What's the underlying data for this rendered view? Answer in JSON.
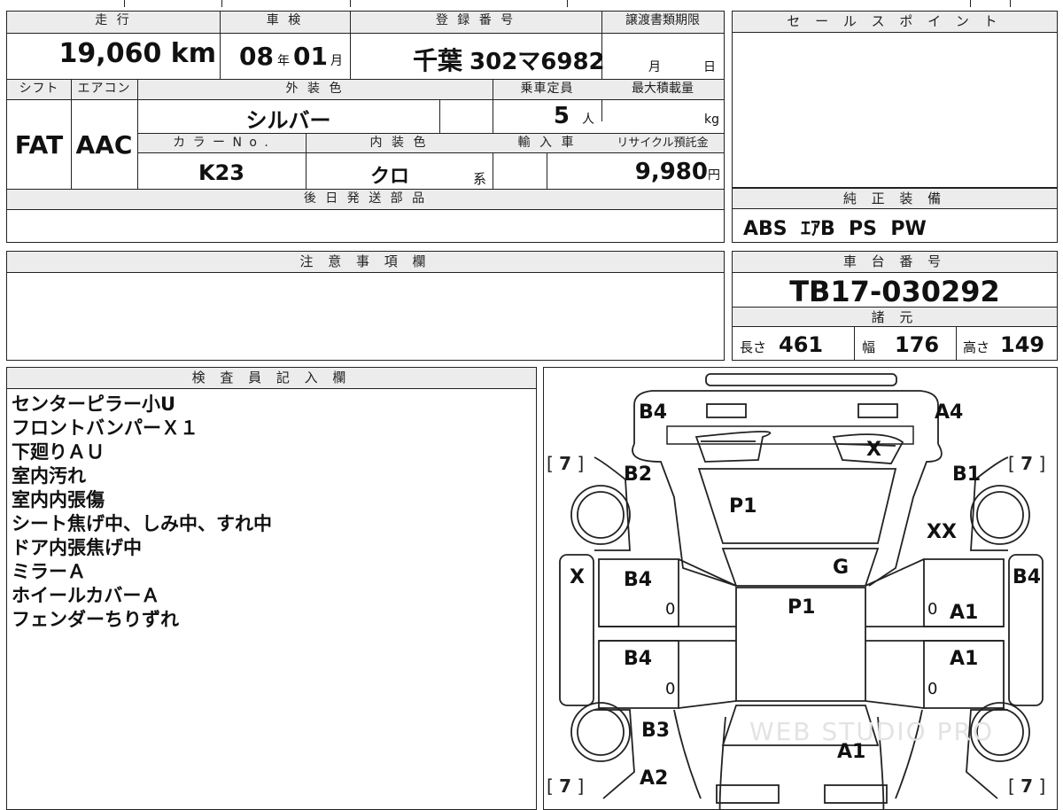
{
  "top": {
    "mileage_label": "走 行",
    "mileage_value": "19,060",
    "mileage_unit": "km",
    "inspection_label": "車 検",
    "inspection_year": "08",
    "inspection_year_unit": "年",
    "inspection_month": "01",
    "inspection_month_unit": "月",
    "registration_label": "登 録 番 号",
    "registration_area": "千葉",
    "registration_number": "302マ6982",
    "transfer_label": "譲渡書類期限",
    "transfer_month": "月",
    "transfer_day": "日"
  },
  "row2": {
    "shift_label": "シフト",
    "shift_value": "FAT",
    "ac_label": "エアコン",
    "ac_value": "AAC",
    "exterior_color_label": "外 装 色",
    "exterior_color_value": "シルバー",
    "capacity_label": "乗車定員",
    "capacity_value": "5",
    "capacity_unit": "人",
    "max_load_label": "最大積載量",
    "max_load_unit": "kg",
    "color_no_label": "カ ラ ー N o .",
    "color_no_value": "K23",
    "interior_color_label": "内 装 色",
    "interior_color_value": "クロ",
    "interior_color_suffix": "系",
    "import_label": "輸 入 車",
    "recycle_label": "リサイクル預託金",
    "recycle_value": "9,980",
    "recycle_unit": "円"
  },
  "later_parts_label": "後 日 発 送 部 品",
  "notes_label": "注 意 事 項 欄",
  "sales_point_label": "セ ー ル ス ポ イ ン ト",
  "equipment": {
    "label": "純 正 装 備",
    "value": "ABS  ｴｱB  PS  PW"
  },
  "chassis": {
    "label": "車 台 番 号",
    "value": "TB17-030292"
  },
  "specs": {
    "label": "諸 元",
    "length_label": "長さ",
    "length_value": "461",
    "width_label": "幅",
    "width_value": "176",
    "height_label": "高さ",
    "height_value": "149"
  },
  "inspector": {
    "label": "検 査 員 記 入 欄",
    "lines": [
      "センターピラー小U",
      "フロントバンパーＸ１",
      "下廻りＡＵ",
      "室内汚れ",
      "室内内張傷",
      "シート焦げ中、しみ中、すれ中",
      "ドア内張焦げ中",
      "ミラーＡ",
      "ホイールカバーＡ",
      "フェンダーちりずれ"
    ]
  },
  "diagram": {
    "marks": {
      "rear_left": "B4",
      "rear_right": "A4",
      "rear_glass": "X",
      "rear_left_quarter": "B2",
      "rear_right_quarter": "B1",
      "roof_rear": "P1",
      "right_rear_wheel": "XX",
      "left_side_panel": "X",
      "roof_glass": "G",
      "right_side_panel": "B4",
      "left_rear_door": "B4",
      "roof": "P1",
      "right_rear_door": "A1",
      "left_front_door": "B4",
      "right_front_door": "A1",
      "left_front_fender": "B3",
      "hood": "A1",
      "front_left": "A2"
    },
    "zeros": [
      "0",
      "0",
      "0",
      "0"
    ],
    "tire_depth": [
      "7",
      "7",
      "7",
      "7"
    ],
    "watermark": "WEB STUDIO PRO"
  }
}
